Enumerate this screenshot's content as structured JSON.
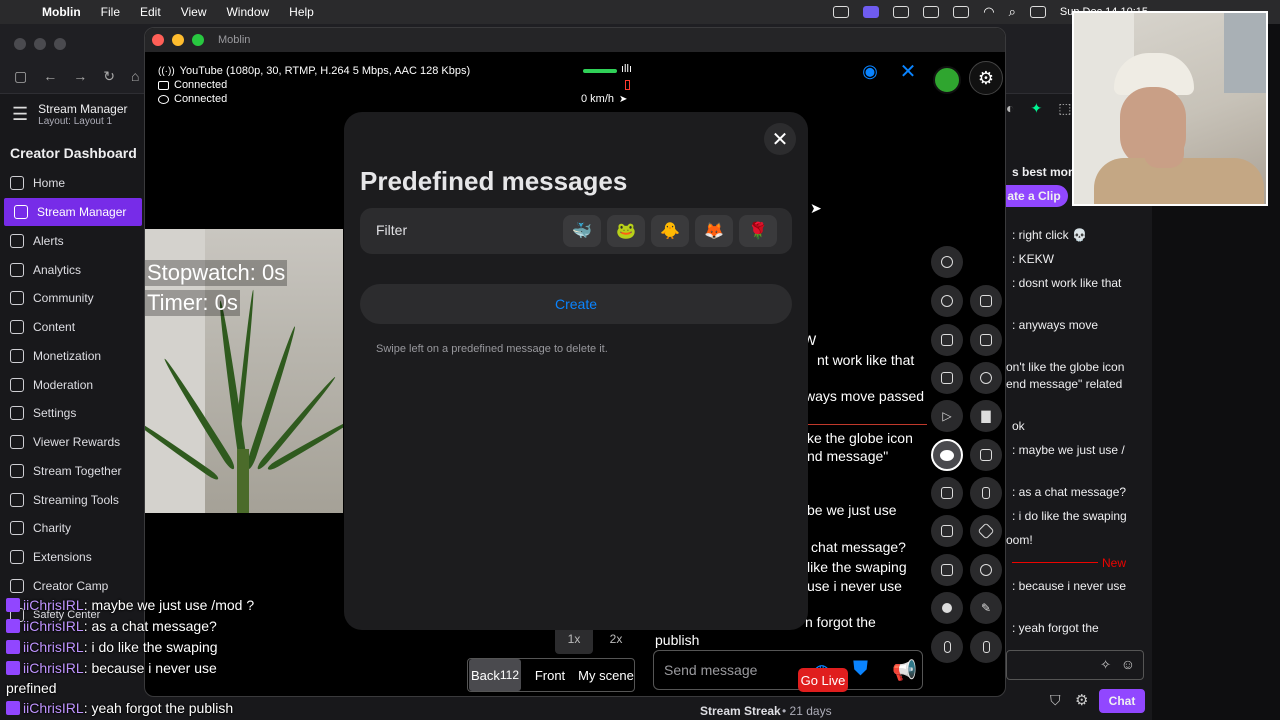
{
  "menubar": {
    "app": "Moblin",
    "menus": [
      "File",
      "Edit",
      "View",
      "Window",
      "Help"
    ],
    "clock": "Sun Dec 14  10:15"
  },
  "twitch": {
    "stream_manager_title": "Stream Manager",
    "layout": "Layout: Layout 1",
    "dashboard_title": "Creator Dashboard",
    "nav": [
      {
        "label": "Home"
      },
      {
        "label": "Stream Manager"
      },
      {
        "label": "Alerts"
      },
      {
        "label": "Analytics"
      },
      {
        "label": "Community"
      },
      {
        "label": "Content"
      },
      {
        "label": "Monetization"
      },
      {
        "label": "Moderation"
      },
      {
        "label": "Settings"
      },
      {
        "label": "Viewer Rewards"
      },
      {
        "label": "Stream Together"
      },
      {
        "label": "Streaming Tools"
      },
      {
        "label": "Charity"
      },
      {
        "label": "Extensions"
      },
      {
        "label": "Creator Camp"
      },
      {
        "label": "Safety Center"
      }
    ],
    "chat": {
      "best_moments": "s best mom",
      "clip_button": "ate a Clip",
      "messages": [
        ": right click 💀",
        ": KEKW",
        ": dosnt work like that",
        ": anyways move",
        "on't like the globe icon",
        "end message\" related",
        "ok",
        ": maybe we just use /",
        ": as a chat message?",
        ": i do like the swaping",
        "oom!",
        ": because i never use",
        ": yeah forgot the"
      ],
      "new_label": "New",
      "chat_button": "Chat",
      "streak": "Stream Streak",
      "streak_days": "• 21 days"
    }
  },
  "moblin": {
    "window_title": "Moblin",
    "status": {
      "stream": "YouTube (1080p, 30, RTMP, H.264 5 Mbps, AAC 128 Kbps)",
      "line2": "Connected",
      "line3": "Connected",
      "speed": "0 km/h"
    },
    "camera": {
      "stopwatch": "Stopwatch: 0s",
      "timer": "Timer: 0s"
    },
    "chat_partial": [
      "W",
      "nt work like that",
      "ways move passed",
      "ke the globe icon",
      "nd message\"",
      "be we just use",
      "chat message?",
      "like the swaping",
      "use i never use",
      "n forgot the",
      "publish"
    ],
    "bottom": {
      "zoom": [
        "1x",
        "2x"
      ],
      "scenes": [
        "Back",
        "Front",
        "My scene"
      ],
      "back_badge": "112",
      "send_placeholder": "Send message",
      "go_live": "Go Live"
    }
  },
  "modal": {
    "title": "Predefined messages",
    "filter_label": "Filter",
    "filter_emojis": [
      "🐳",
      "🐸",
      "🐥",
      "🦊",
      "🌹"
    ],
    "create_label": "Create",
    "hint": "Swipe left on a predefined message to delete it."
  },
  "overlay_chat": [
    {
      "user": "iiChrisIRL",
      "text": ": maybe we just use /mod ?"
    },
    {
      "user": "iiChrisIRL",
      "text": ": as a chat message?"
    },
    {
      "user": "iiChrisIRL",
      "text": ": i do like the swaping"
    },
    {
      "user": "iiChrisIRL",
      "text": ": because i never use"
    },
    {
      "user": "",
      "text": "prefined"
    },
    {
      "user": "iiChrisIRL",
      "text": ": yeah forgot the publish"
    }
  ],
  "colors": {
    "accent_purple": "#772ce8",
    "moblin_blue": "#0a84ff",
    "go_live_red": "#e01e1e"
  }
}
